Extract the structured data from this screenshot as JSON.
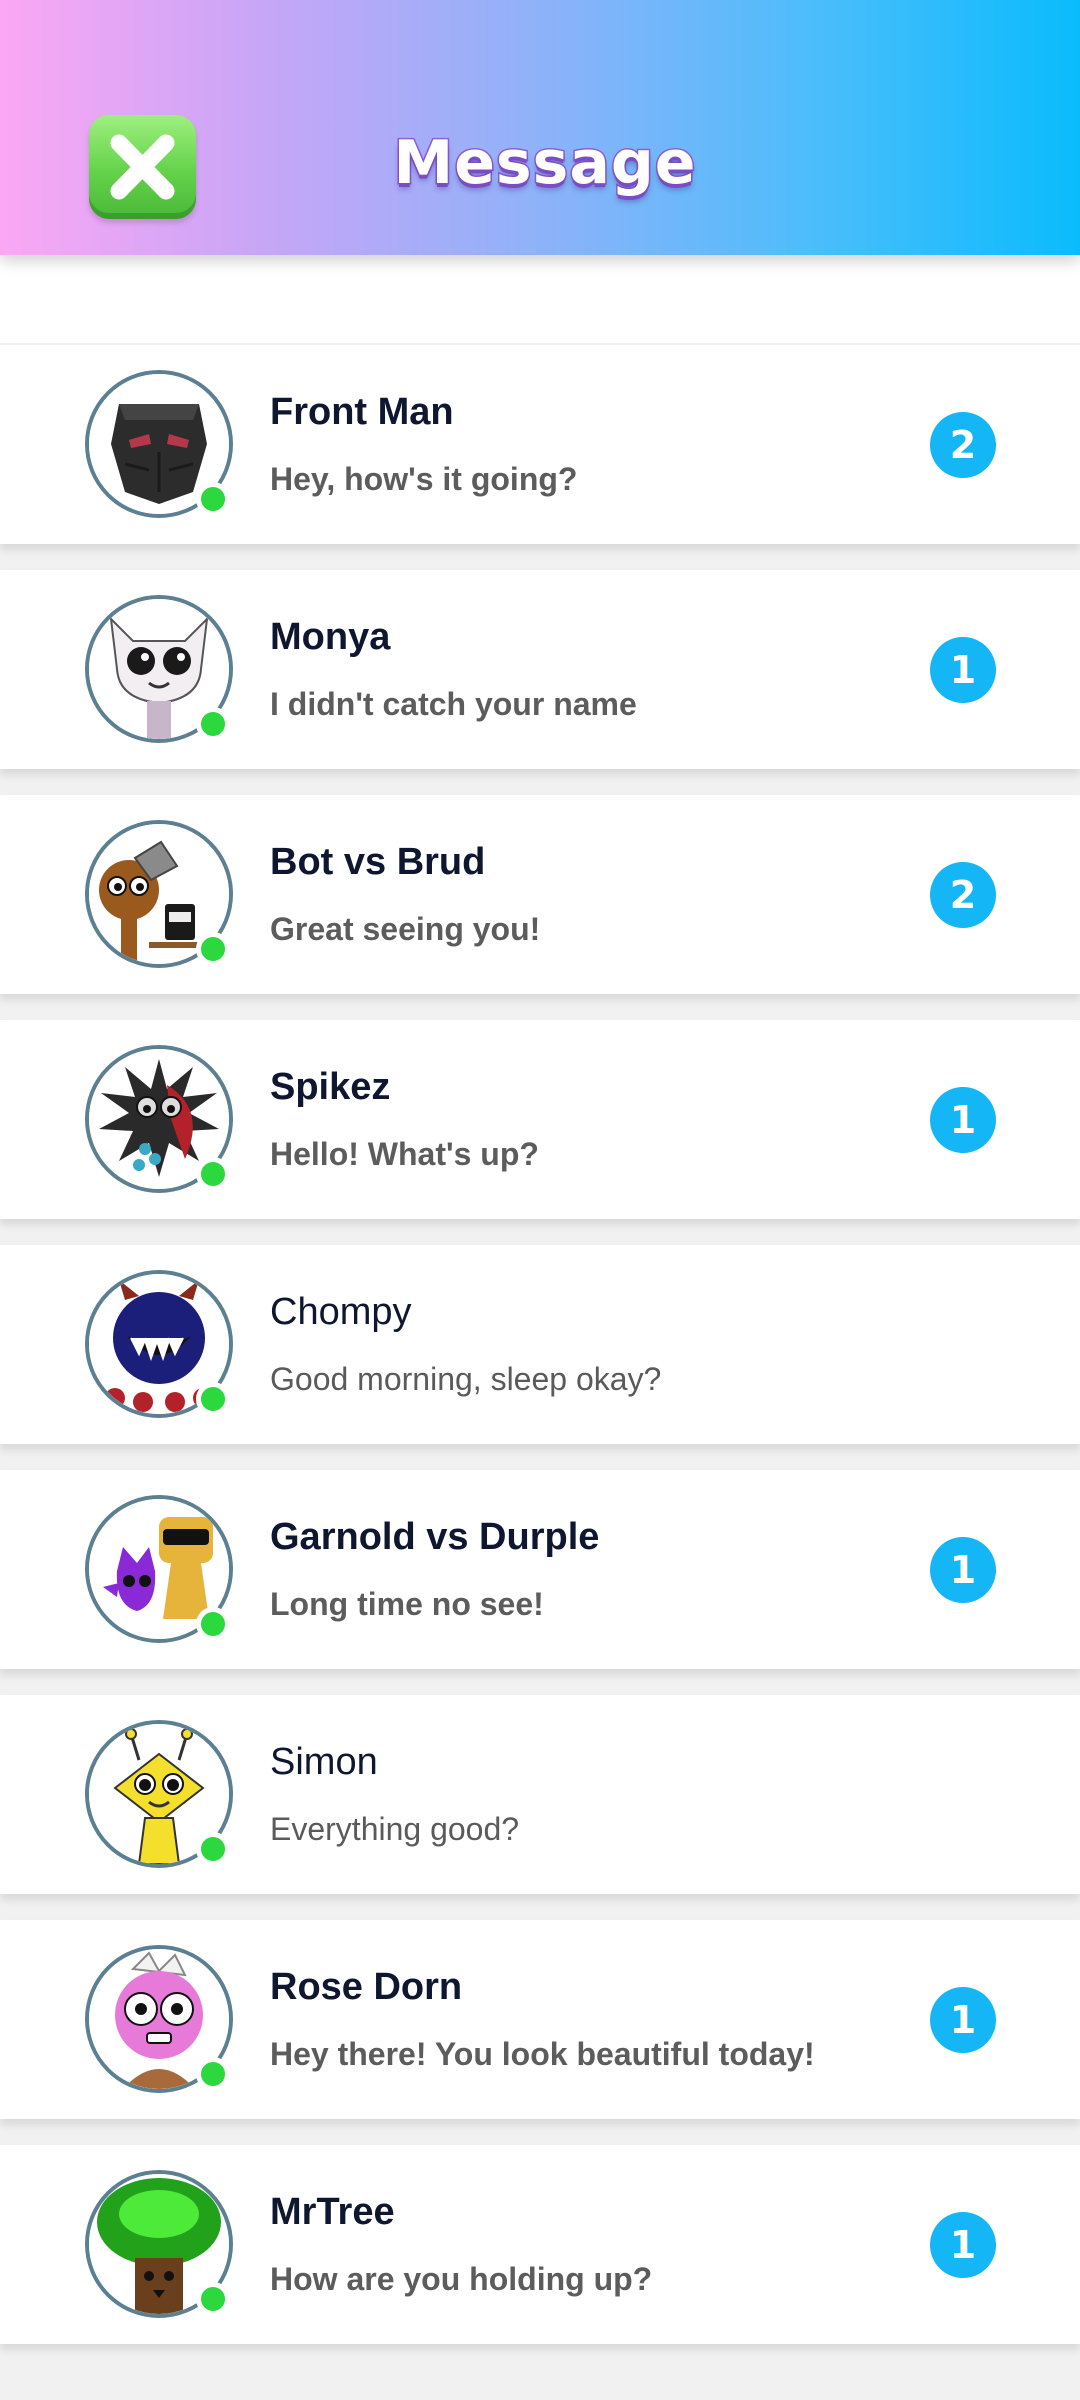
{
  "header": {
    "title": "Message",
    "colors": {
      "gradient_left": "#fba7f4",
      "gradient_right": "#0abcfc",
      "close_button": "#64d24a"
    }
  },
  "badge_color": "#14b6f5",
  "online_color": "#2bd83d",
  "conversations": [
    {
      "name": "Front Man",
      "preview": "Hey, how's it going?",
      "unread": "2",
      "online": true,
      "avatar_icon": "front-man-mask-icon"
    },
    {
      "name": "Monya",
      "preview": "I didn't catch your name",
      "unread": "1",
      "online": true,
      "avatar_icon": "monya-cat-icon"
    },
    {
      "name": "Bot vs Brud",
      "preview": "Great seeing you!",
      "unread": "2",
      "online": true,
      "avatar_icon": "bot-vs-brud-icon"
    },
    {
      "name": "Spikez",
      "preview": "Hello! What's up?",
      "unread": "1",
      "online": true,
      "avatar_icon": "spikez-icon"
    },
    {
      "name": "Chompy",
      "preview": "Good morning, sleep okay?",
      "unread": "",
      "online": true,
      "avatar_icon": "chompy-icon"
    },
    {
      "name": "Garnold vs Durple",
      "preview": "Long time no see!",
      "unread": "1",
      "online": true,
      "avatar_icon": "garnold-vs-durple-icon"
    },
    {
      "name": "Simon",
      "preview": "Everything good?",
      "unread": "",
      "online": true,
      "avatar_icon": "simon-icon"
    },
    {
      "name": "Rose Dorn",
      "preview": "Hey there! You look beautiful today!",
      "unread": "1",
      "online": true,
      "avatar_icon": "rose-dorn-icon"
    },
    {
      "name": "MrTree",
      "preview": "How are you holding up?",
      "unread": "1",
      "online": true,
      "avatar_icon": "mrtree-icon"
    }
  ]
}
